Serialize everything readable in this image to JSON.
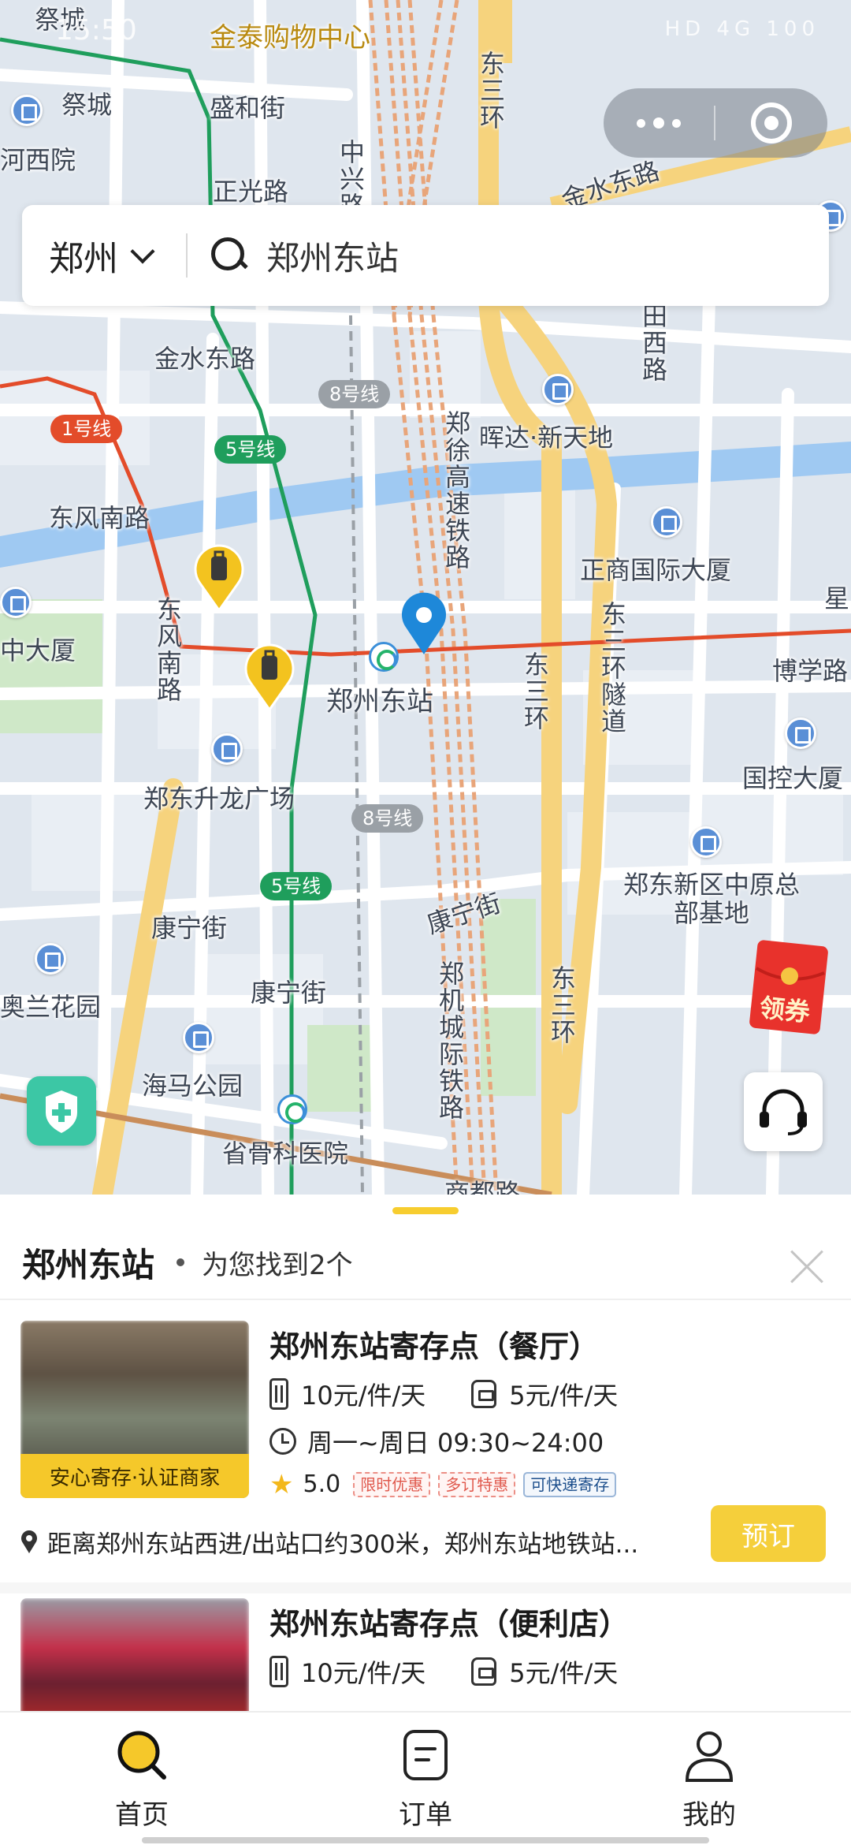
{
  "status_bar": {
    "time": "15:50",
    "indicators": "HD 4G 100"
  },
  "map": {
    "roads": [
      {
        "name": "祭城",
        "kind": "area"
      },
      {
        "name": "金泰购物中心",
        "kind": "poi"
      },
      {
        "name": "盛和街",
        "kind": "road"
      },
      {
        "name": "东三环",
        "kind": "road"
      },
      {
        "name": "祭城",
        "kind": "area"
      },
      {
        "name": "河西院",
        "kind": "area"
      },
      {
        "name": "正光路",
        "kind": "road"
      },
      {
        "name": "中兴路",
        "kind": "road"
      },
      {
        "name": "金水东路",
        "kind": "road"
      },
      {
        "name": "金水东路",
        "kind": "road"
      },
      {
        "name": "田西路",
        "kind": "road"
      },
      {
        "name": "晖达·新天地",
        "kind": "poi"
      },
      {
        "name": "郑徐高速铁路",
        "kind": "rail"
      },
      {
        "name": "东风南路",
        "kind": "road"
      },
      {
        "name": "正商国际大厦",
        "kind": "poi"
      },
      {
        "name": "星",
        "kind": "cut"
      },
      {
        "name": "中大厦",
        "kind": "poi"
      },
      {
        "name": "东风南路",
        "kind": "road"
      },
      {
        "name": "郑州东站",
        "kind": "station"
      },
      {
        "name": "东三环",
        "kind": "road"
      },
      {
        "name": "东三环隧道",
        "kind": "road"
      },
      {
        "name": "博学路",
        "kind": "road"
      },
      {
        "name": "国控大厦",
        "kind": "poi"
      },
      {
        "name": "郑东升龙广场",
        "kind": "poi"
      },
      {
        "name": "郑东新区中原总部基地",
        "kind": "poi"
      },
      {
        "name": "康宁街",
        "kind": "road"
      },
      {
        "name": "康宁街",
        "kind": "road"
      },
      {
        "name": "康宁街",
        "kind": "road"
      },
      {
        "name": "郑机城际铁路",
        "kind": "rail"
      },
      {
        "name": "东三环",
        "kind": "road"
      },
      {
        "name": "奥兰花园",
        "kind": "poi"
      },
      {
        "name": "海马公园",
        "kind": "poi"
      },
      {
        "name": "省骨科医院",
        "kind": "poi"
      },
      {
        "name": "商都路",
        "kind": "road"
      }
    ],
    "line_badges": {
      "line8_a": "8号线",
      "line1": "1号线",
      "line5_a": "5号线",
      "line8_b": "8号线",
      "line5_b": "5号线"
    },
    "coupon_label": "领券"
  },
  "search": {
    "city": "郑州",
    "query": "郑州东站"
  },
  "results": {
    "location": "郑州东站",
    "summary": "为您找到2个"
  },
  "listings": [
    {
      "name": "郑州东站寄存点（餐厅）",
      "price_luggage": "10元/件/天",
      "price_bag": "5元/件/天",
      "hours": "周一~周日 09:30~24:00",
      "rating": "5.0",
      "tags": [
        "限时优惠",
        "多订特惠",
        "可快递寄存"
      ],
      "badge": "安心寄存·认证商家",
      "address": "距离郑州东站西进/出站口约300米，郑州东站地铁站...",
      "book_label": "预订"
    },
    {
      "name": "郑州东站寄存点（便利店）",
      "price_luggage": "10元/件/天",
      "price_bag": "5元/件/天"
    }
  ],
  "tabs": [
    {
      "label": "首页",
      "icon": "search-icon",
      "active": true
    },
    {
      "label": "订单",
      "icon": "order-icon",
      "active": false
    },
    {
      "label": "我的",
      "icon": "profile-icon",
      "active": false
    }
  ],
  "colors": {
    "brand_yellow": "#f5cf3b",
    "metro_line1": "#e34c2a",
    "metro_line5": "#1f9e5c",
    "metro_line8": "#9aa0a6",
    "pin_blue": "#1e88d9"
  }
}
